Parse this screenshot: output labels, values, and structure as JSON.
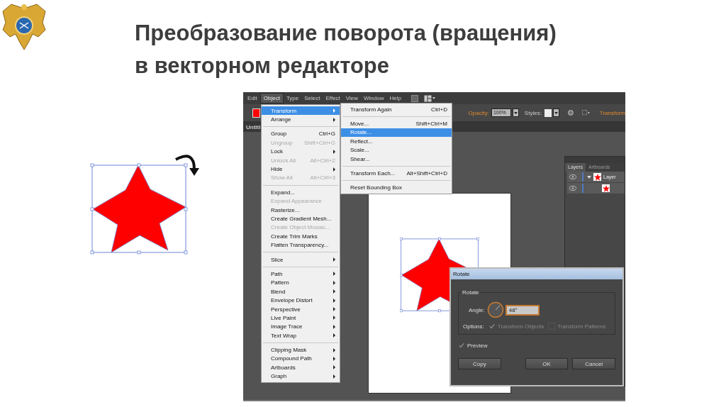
{
  "slide": {
    "title_lines": [
      "Преобразование поворота (вращения)",
      "в векторном редакторе"
    ]
  },
  "app": {
    "menubar": [
      {
        "label": "Edit",
        "selected": false
      },
      {
        "label": "Object",
        "selected": true
      },
      {
        "label": "Type",
        "selected": false
      },
      {
        "label": "Select",
        "selected": false
      },
      {
        "label": "Effect",
        "selected": false
      },
      {
        "label": "View",
        "selected": false
      },
      {
        "label": "Window",
        "selected": false
      },
      {
        "label": "Help",
        "selected": false
      }
    ],
    "control_bar": {
      "opacity_label": "Opacity:",
      "opacity_value": "100%",
      "styles_label": "Styles:",
      "transform_link": "Transform"
    },
    "document_tab": "Untitl",
    "object_menu": [
      {
        "kind": "item",
        "label": "Transform",
        "submenu": true,
        "disabled": false,
        "selected": true
      },
      {
        "kind": "item",
        "label": "Arrange",
        "submenu": true,
        "disabled": false,
        "selected": false
      },
      {
        "kind": "separator"
      },
      {
        "kind": "item",
        "label": "Group",
        "shortcut": "Ctrl+G",
        "submenu": false,
        "disabled": false,
        "selected": false
      },
      {
        "kind": "item",
        "label": "Ungroup",
        "shortcut": "Shift+Ctrl+G",
        "submenu": false,
        "disabled": true,
        "selected": false
      },
      {
        "kind": "item",
        "label": "Lock",
        "submenu": true,
        "disabled": false,
        "selected": false
      },
      {
        "kind": "item",
        "label": "Unlock All",
        "shortcut": "Alt+Ctrl+2",
        "submenu": false,
        "disabled": true,
        "selected": false
      },
      {
        "kind": "item",
        "label": "Hide",
        "submenu": true,
        "disabled": false,
        "selected": false
      },
      {
        "kind": "item",
        "label": "Show All",
        "shortcut": "Alt+Ctrl+3",
        "submenu": false,
        "disabled": true,
        "selected": false
      },
      {
        "kind": "separator"
      },
      {
        "kind": "item",
        "label": "Expand...",
        "submenu": false,
        "disabled": false,
        "selected": false
      },
      {
        "kind": "item",
        "label": "Expand Appearance",
        "submenu": false,
        "disabled": true,
        "selected": false
      },
      {
        "kind": "item",
        "label": "Rasterize...",
        "submenu": false,
        "disabled": false,
        "selected": false
      },
      {
        "kind": "item",
        "label": "Create Gradient Mesh...",
        "submenu": false,
        "disabled": false,
        "selected": false
      },
      {
        "kind": "item",
        "label": "Create Object Mosaic...",
        "submenu": false,
        "disabled": true,
        "selected": false
      },
      {
        "kind": "item",
        "label": "Create Trim Marks",
        "submenu": false,
        "disabled": false,
        "selected": false
      },
      {
        "kind": "item",
        "label": "Flatten Transparency...",
        "submenu": false,
        "disabled": false,
        "selected": false
      },
      {
        "kind": "separator"
      },
      {
        "kind": "item",
        "label": "Slice",
        "submenu": true,
        "disabled": false,
        "selected": false
      },
      {
        "kind": "separator"
      },
      {
        "kind": "item",
        "label": "Path",
        "submenu": true,
        "disabled": false,
        "selected": false
      },
      {
        "kind": "item",
        "label": "Pattern",
        "submenu": true,
        "disabled": false,
        "selected": false
      },
      {
        "kind": "item",
        "label": "Blend",
        "submenu": true,
        "disabled": false,
        "selected": false
      },
      {
        "kind": "item",
        "label": "Envelope Distort",
        "submenu": true,
        "disabled": false,
        "selected": false
      },
      {
        "kind": "item",
        "label": "Perspective",
        "submenu": true,
        "disabled": false,
        "selected": false
      },
      {
        "kind": "item",
        "label": "Live Paint",
        "submenu": true,
        "disabled": false,
        "selected": false
      },
      {
        "kind": "item",
        "label": "Image Trace",
        "submenu": true,
        "disabled": false,
        "selected": false
      },
      {
        "kind": "item",
        "label": "Text Wrap",
        "submenu": true,
        "disabled": false,
        "selected": false
      },
      {
        "kind": "separator"
      },
      {
        "kind": "item",
        "label": "Clipping Mask",
        "submenu": true,
        "disabled": false,
        "selected": false
      },
      {
        "kind": "item",
        "label": "Compound Path",
        "submenu": true,
        "disabled": false,
        "selected": false
      },
      {
        "kind": "item",
        "label": "Artboards",
        "submenu": true,
        "disabled": false,
        "selected": false
      },
      {
        "kind": "item",
        "label": "Graph",
        "submenu": true,
        "disabled": false,
        "selected": false
      }
    ],
    "transform_submenu": [
      {
        "kind": "item",
        "label": "Transform Again",
        "shortcut": "Ctrl+D",
        "submenu": false,
        "disabled": false,
        "selected": false
      },
      {
        "kind": "separator"
      },
      {
        "kind": "item",
        "label": "Move...",
        "shortcut": "Shift+Ctrl+M",
        "submenu": false,
        "disabled": false,
        "selected": false
      },
      {
        "kind": "item",
        "label": "Rotate...",
        "submenu": false,
        "disabled": false,
        "selected": true
      },
      {
        "kind": "item",
        "label": "Reflect...",
        "submenu": false,
        "disabled": false,
        "selected": false
      },
      {
        "kind": "item",
        "label": "Scale...",
        "submenu": false,
        "disabled": false,
        "selected": false
      },
      {
        "kind": "item",
        "label": "Shear...",
        "submenu": false,
        "disabled": false,
        "selected": false
      },
      {
        "kind": "separator"
      },
      {
        "kind": "item",
        "label": "Transform Each...",
        "shortcut": "Alt+Shift+Ctrl+D",
        "submenu": false,
        "disabled": false,
        "selected": false
      },
      {
        "kind": "separator"
      },
      {
        "kind": "item",
        "label": "Reset Bounding Box",
        "submenu": false,
        "disabled": false,
        "selected": false
      }
    ],
    "layers_panel": {
      "tabs": [
        {
          "label": "Layers",
          "selected": true
        },
        {
          "label": "Artboards",
          "selected": false
        }
      ],
      "rows": [
        {
          "kind": "layer",
          "label": "Layer",
          "expanded": true
        },
        {
          "kind": "object"
        }
      ]
    },
    "rotate_dialog": {
      "title": "Rotate",
      "group_label": "Rotate",
      "angle_label": "Angle:",
      "angle_value": "48°",
      "options_label": "Options:",
      "options": [
        {
          "label": "Transform Objects",
          "checked": true,
          "disabled": true
        },
        {
          "label": "Transform Patterns",
          "checked": false,
          "disabled": true
        }
      ],
      "preview": {
        "label": "Preview",
        "checked": true
      },
      "buttons": [
        {
          "label": "Copy"
        },
        {
          "label": "OK"
        },
        {
          "label": "Cancel"
        }
      ]
    }
  }
}
